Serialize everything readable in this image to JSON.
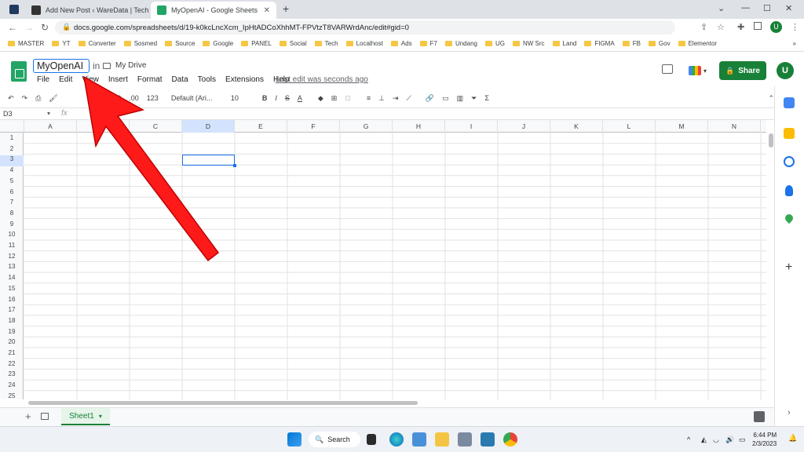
{
  "browser": {
    "tabs": [
      {
        "title": "Add New Post ‹ WareData | Tech",
        "icon": "wordpress-icon"
      },
      {
        "title": "MyOpenAI - Google Sheets",
        "icon": "sheets-icon"
      }
    ],
    "new_tab": "+",
    "window_controls": [
      "⌄",
      "—",
      "☐",
      "✕"
    ],
    "url": "docs.google.com/spreadsheets/d/19-k0kcLncXcm_IpHtADCoXhhMT-FPVtzT8VARWrdAnc/edit#gid=0",
    "bookmarks": [
      "MASTER",
      "YT",
      "Converter",
      "Sosmed",
      "Source",
      "Google",
      "PANEL",
      "Social",
      "Tech",
      "Localhost",
      "Ads",
      "F7",
      "Undang",
      "UG",
      "NW Src",
      "Land",
      "FIGMA",
      "FB",
      "Gov",
      "Elementor"
    ],
    "bookmarks_more": "»",
    "profile_initial": "U"
  },
  "sheets": {
    "doc_title": "MyOpenAI",
    "in_label": "in",
    "location": "My Drive",
    "menu": [
      "File",
      "Edit",
      "View",
      "Insert",
      "Format",
      "Data",
      "Tools",
      "Extensions",
      "Help"
    ],
    "last_edit": "Last edit was seconds ago",
    "share_label": "Share",
    "avatar_initial": "U",
    "toolbar": {
      "percent": "%",
      "decimal_decrease": ".0",
      "decimal_increase": ".00",
      "number_format": "123",
      "font": "Default (Ari...",
      "font_size": "10",
      "bold": "B",
      "italic": "I",
      "strike": "S",
      "text_color": "A",
      "dollar": "$"
    },
    "name_box": "D3",
    "fx": "fx",
    "columns": [
      "A",
      "B",
      "C",
      "D",
      "E",
      "F",
      "G",
      "H",
      "I",
      "J",
      "K",
      "L",
      "M",
      "N"
    ],
    "rows": [
      "1",
      "2",
      "3",
      "4",
      "5",
      "6",
      "7",
      "8",
      "9",
      "10",
      "11",
      "12",
      "13",
      "14",
      "15",
      "16",
      "17",
      "18",
      "19",
      "20",
      "21",
      "22",
      "23",
      "24",
      "25"
    ],
    "selected_cell": "D3",
    "sheet_tab": "Sheet1",
    "sheet_tab_caret": "▾"
  },
  "taskbar": {
    "search_label": "Search",
    "time": "6:44 PM",
    "date": "2/3/2023"
  },
  "colors": {
    "accent_green": "#188038",
    "selection_blue": "#1a73e8",
    "arrow_red": "#ff0000"
  }
}
